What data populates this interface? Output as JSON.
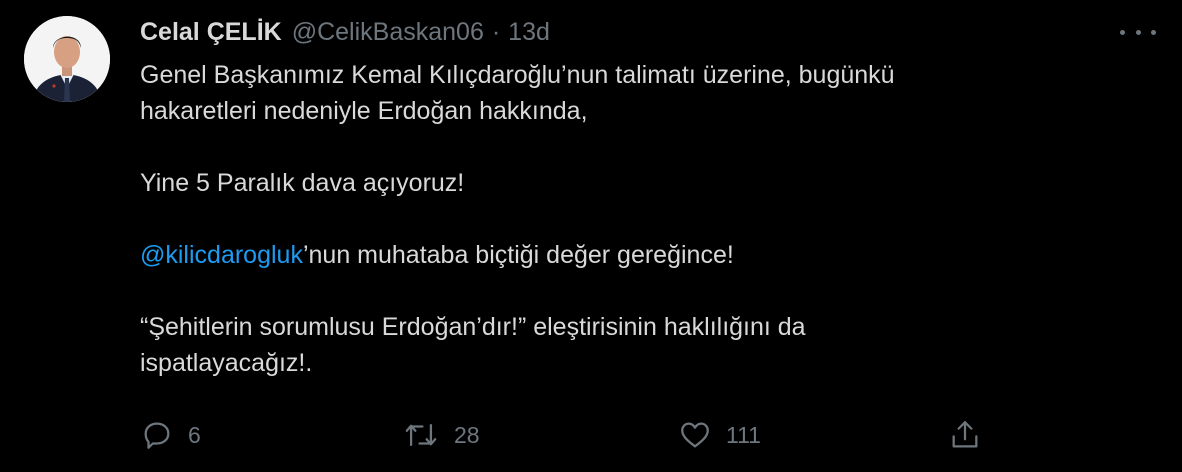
{
  "tweet": {
    "display_name": "Celal ÇELİK",
    "handle": "@CelikBaskan06",
    "separator": "·",
    "time": "13d",
    "paragraphs": [
      [
        "Genel Başkanımız Kemal Kılıçdaroğlu’nun talimatı üzerine, bugünkü",
        "hakaretleri nedeniyle Erdoğan hakkında,"
      ],
      [
        "Yine 5 Paralık dava açıyoruz!"
      ],
      [
        "’nun muhataba biçtiği değer gereğince!"
      ],
      [
        "“Şehitlerin sorumlusu Erdoğan’dır!” eleştirisinin haklılığını da",
        "ispatlayacağız!."
      ]
    ],
    "mention": "@kilicdarogluk"
  },
  "actions": {
    "reply_count": "6",
    "retweet_count": "28",
    "like_count": "111"
  },
  "colors": {
    "background": "#000000",
    "text": "#d9d9d9",
    "muted": "#6e767d",
    "link": "#1d9bf0"
  },
  "icons": [
    "avatar",
    "more-icon",
    "reply-icon",
    "retweet-icon",
    "like-icon",
    "share-icon"
  ]
}
